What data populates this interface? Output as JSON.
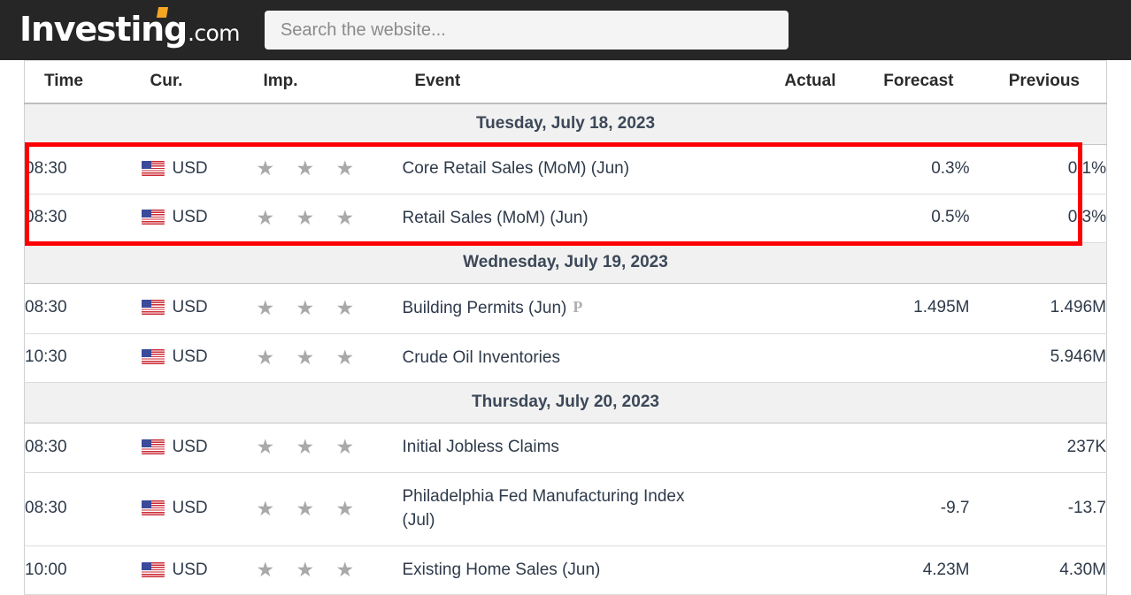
{
  "header": {
    "logo_main": "Investing",
    "logo_tld": ".com",
    "search_placeholder": "Search the website...",
    "search_value": "",
    "bar_color": "#262626",
    "accent_color": "#f5a623"
  },
  "table": {
    "columns": [
      "Time",
      "Cur.",
      "Imp.",
      "Event",
      "Actual",
      "Forecast",
      "Previous"
    ],
    "rows": [
      {
        "kind": "date",
        "label": "Tuesday, July 18, 2023"
      },
      {
        "kind": "event",
        "time": "08:30",
        "currency": "USD",
        "flag": "us-flag-icon",
        "importance": 3,
        "stars": "★ ★ ★",
        "event": "Core Retail Sales (MoM) (Jun)",
        "badge": "",
        "actual": "",
        "forecast": "0.3%",
        "previous": "0.1%",
        "highlighted": true
      },
      {
        "kind": "event",
        "time": "08:30",
        "currency": "USD",
        "flag": "us-flag-icon",
        "importance": 3,
        "stars": "★ ★ ★",
        "event": "Retail Sales (MoM) (Jun)",
        "badge": "",
        "actual": "",
        "forecast": "0.5%",
        "previous": "0.3%",
        "highlighted": true
      },
      {
        "kind": "date",
        "label": "Wednesday, July 19, 2023"
      },
      {
        "kind": "event",
        "time": "08:30",
        "currency": "USD",
        "flag": "us-flag-icon",
        "importance": 3,
        "stars": "★ ★ ★",
        "event": "Building Permits (Jun)",
        "badge": "P",
        "actual": "",
        "forecast": "1.495M",
        "previous": "1.496M",
        "highlighted": false
      },
      {
        "kind": "event",
        "time": "10:30",
        "currency": "USD",
        "flag": "us-flag-icon",
        "importance": 3,
        "stars": "★ ★ ★",
        "event": "Crude Oil Inventories",
        "badge": "",
        "actual": "",
        "forecast": "",
        "previous": "5.946M",
        "highlighted": false
      },
      {
        "kind": "date",
        "label": "Thursday, July 20, 2023"
      },
      {
        "kind": "event",
        "time": "08:30",
        "currency": "USD",
        "flag": "us-flag-icon",
        "importance": 3,
        "stars": "★ ★ ★",
        "event": "Initial Jobless Claims",
        "badge": "",
        "actual": "",
        "forecast": "",
        "previous": "237K",
        "highlighted": false
      },
      {
        "kind": "event",
        "time": "08:30",
        "currency": "USD",
        "flag": "us-flag-icon",
        "importance": 3,
        "stars": "★ ★ ★",
        "event": "Philadelphia Fed Manufacturing Index (Jul)",
        "badge": "",
        "actual": "",
        "forecast": "-9.7",
        "previous": "-13.7",
        "highlighted": false
      },
      {
        "kind": "event",
        "time": "10:00",
        "currency": "USD",
        "flag": "us-flag-icon",
        "importance": 3,
        "stars": "★ ★ ★",
        "event": "Existing Home Sales (Jun)",
        "badge": "",
        "actual": "",
        "forecast": "4.23M",
        "previous": "4.30M",
        "highlighted": false
      }
    ]
  },
  "annotation": {
    "type": "rectangle-highlight",
    "color": "#ff0000",
    "covers": [
      "Core Retail Sales (MoM) (Jun)",
      "Retail Sales (MoM) (Jun)"
    ]
  }
}
